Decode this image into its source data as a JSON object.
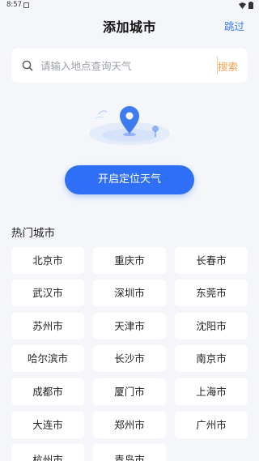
{
  "status_bar": {
    "time": "8:57"
  },
  "header": {
    "title": "添加城市",
    "skip_label": "跳过"
  },
  "search": {
    "placeholder": "请输入地点查询天气",
    "button_label": "搜索"
  },
  "locate_button_label": "开启定位天气",
  "hot_cities": {
    "title": "热门城市",
    "items": [
      "北京市",
      "重庆市",
      "长春市",
      "武汉市",
      "深圳市",
      "东莞市",
      "苏州市",
      "天津市",
      "沈阳市",
      "哈尔滨市",
      "长沙市",
      "南京市",
      "成都市",
      "厦门市",
      "上海市",
      "大连市",
      "郑州市",
      "广州市",
      "杭州市",
      "青岛市"
    ]
  },
  "colors": {
    "accent": "#2f6ff5",
    "link": "#3a7bea",
    "search_button": "#f0a24e",
    "background": "#f4f6fa"
  },
  "icons": [
    "search-icon",
    "location-pin-icon",
    "wifi-icon",
    "battery-icon"
  ]
}
